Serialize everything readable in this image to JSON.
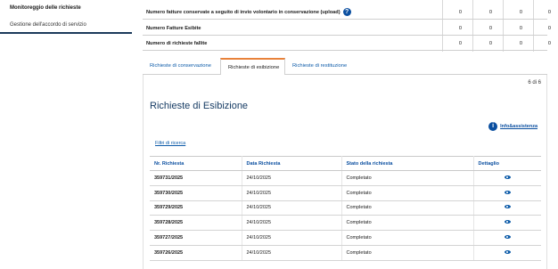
{
  "sidebar": {
    "items": [
      {
        "label": "Monitoreggio delle richieste"
      },
      {
        "label": "Gestione dell'accordo di servizio"
      }
    ]
  },
  "summary": {
    "rows": [
      {
        "label": "Numero fatture conservate a seguito di invio volontario in conservazione (upload)",
        "values": [
          "0",
          "0",
          "0",
          "0"
        ]
      },
      {
        "label": "Numero Fatture Esibite",
        "values": [
          "0",
          "0",
          "0",
          "0"
        ]
      },
      {
        "label": "Numero di richieste fallite",
        "values": [
          "0",
          "0",
          "0",
          "0"
        ]
      }
    ],
    "help_icon": "question-circle-icon"
  },
  "tabs": [
    {
      "label": "Richieste di conservazione",
      "active": false
    },
    {
      "label": "Richieste di esibizione",
      "active": true
    },
    {
      "label": "Richieste di restituzione",
      "active": false
    }
  ],
  "panel": {
    "pager": "6 di 6",
    "title": "Richieste di Esibizione",
    "info_link": "Info&assistenza",
    "filters_link": "Filtri di ricerca"
  },
  "table": {
    "headers": [
      "Nr. Richiesta",
      "Data Richiesta",
      "Stato della richiesta",
      "Dettaglio"
    ],
    "rows": [
      {
        "nr": "359731/2025",
        "data": "24/10/2025",
        "stato": "Completato"
      },
      {
        "nr": "359730/2025",
        "data": "24/10/2025",
        "stato": "Completato"
      },
      {
        "nr": "359729/2025",
        "data": "24/10/2025",
        "stato": "Completato"
      },
      {
        "nr": "359728/2025",
        "data": "24/10/2025",
        "stato": "Completato"
      },
      {
        "nr": "359727/2025",
        "data": "24/10/2025",
        "stato": "Completato"
      },
      {
        "nr": "359726/2025",
        "data": "24/10/2025",
        "stato": "Completato"
      }
    ]
  },
  "colors": {
    "accent": "#0b4fa0",
    "tab_active_border": "#e8823a",
    "sidebar_active": "#1b3a5b"
  }
}
